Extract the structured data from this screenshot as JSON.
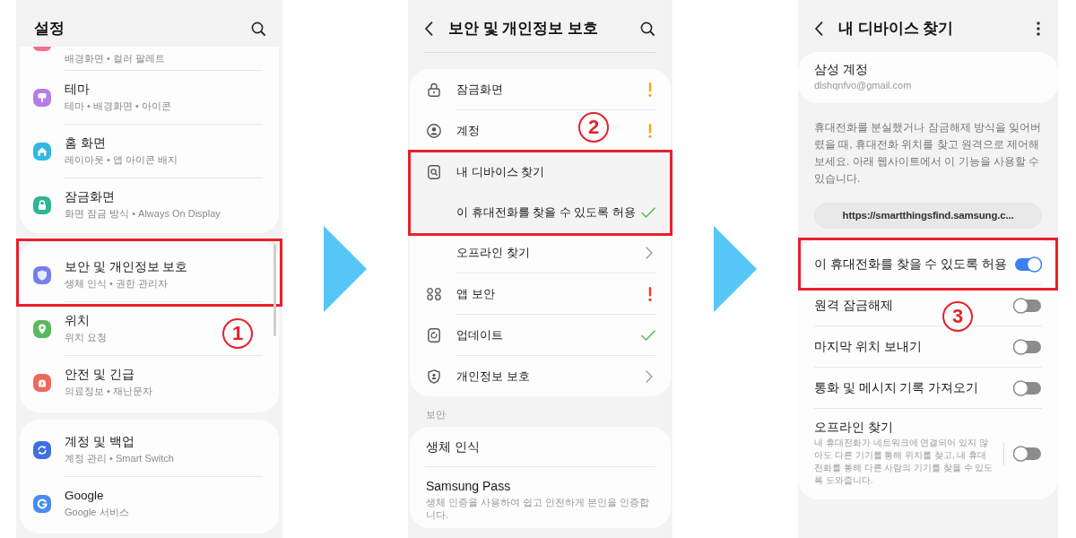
{
  "settings_panel": {
    "title": "설정",
    "groups": [
      {
        "items": [
          {
            "kind": "cut_off",
            "subtitle": "배경화면 • 컬러 팔레트",
            "color": "#f36f8e",
            "highlighted": false
          },
          {
            "kind": "entry",
            "title": "테마",
            "subtitle": "테마 • 배경화면 • 아이콘",
            "color": "#b67ee4",
            "highlighted": false
          },
          {
            "kind": "entry",
            "title": "홈 화면",
            "subtitle": "레이아웃 • 앱 아이콘 배지",
            "color": "#2fb8e3",
            "highlighted": false
          },
          {
            "kind": "entry",
            "title": "잠금화면",
            "subtitle": "화면 잠금 방식 • Always On Display",
            "color": "#2db596",
            "highlighted": false
          }
        ]
      },
      {
        "items": [
          {
            "kind": "entry",
            "title": "보안 및 개인정보 보호",
            "subtitle": "생체 인식 • 권한 관리자",
            "color": "#7480ef",
            "highlighted": true
          },
          {
            "kind": "entry",
            "title": "위치",
            "subtitle": "위치 요청",
            "color": "#5bb85f",
            "highlighted": false
          },
          {
            "kind": "entry",
            "title": "안전 및 긴급",
            "subtitle": "의료정보 • 재난문자",
            "color": "#ec6a5c",
            "highlighted": false
          }
        ]
      },
      {
        "items": [
          {
            "kind": "entry",
            "title": "계정 및 백업",
            "subtitle": "계정 관리 • Smart Switch",
            "color": "#3f6fe0",
            "highlighted": false
          },
          {
            "kind": "entry",
            "title": "Google",
            "subtitle": "Google 서비스",
            "color": "#4a8bf2",
            "highlighted": false
          }
        ]
      }
    ],
    "step_badge": "1"
  },
  "security_panel": {
    "title": "보안 및 개인정보 보호",
    "items": [
      {
        "label": "잠금화면",
        "kind": "warning",
        "highlighted": false
      },
      {
        "label": "계정",
        "kind": "warning",
        "highlighted": false
      },
      {
        "label": "내 디바이스 찾기",
        "kind": "group",
        "highlighted": true,
        "children": [
          {
            "label": "이 휴대전화를 찾을 수 있도록 허용",
            "kind": "done",
            "highlighted": true
          },
          {
            "label": "오프라인 찾기",
            "kind": "link",
            "highlighted": false
          }
        ]
      },
      {
        "label": "앱 보안",
        "kind": "alert",
        "highlighted": false
      },
      {
        "label": "업데이트",
        "kind": "done",
        "highlighted": false
      },
      {
        "label": "개인정보 보호",
        "kind": "link",
        "highlighted": false
      }
    ],
    "step_badge": "2",
    "section": {
      "label": "보안",
      "items": [
        {
          "title": "생체 인식"
        },
        {
          "title": "Samsung Pass",
          "subtitle": "생체 인증을 사용하여 쉽고 안전하게 본인을 인증합니다."
        }
      ]
    }
  },
  "find_device_panel": {
    "title": "내 디바이스 찾기",
    "account": {
      "title": "삼성 계정",
      "email": "dlshqnfvo@gmail.com"
    },
    "description": "휴대전화를 분실했거나 잠금해제 방식을 잊어버렸을 때, 휴대전화 위치를 찾고 원격으로 제어해 보세요. 아래 웹사이트에서 이 기능을 사용할 수 있습니다.",
    "link": "https://smartthingsfind.samsung.c...",
    "toggles": [
      {
        "label": "이 휴대전화를 찾을 수 있도록 허용",
        "on": true,
        "highlighted": true
      },
      {
        "label": "원격 잠금해제",
        "on": false,
        "highlighted": false
      },
      {
        "label": "마지막 위치 보내기",
        "on": false,
        "highlighted": false
      },
      {
        "label": "통화 및 메시지 기록 가져오기",
        "on": false,
        "highlighted": false
      },
      {
        "label": "오프라인 찾기",
        "description": "내 휴대전화가 네트워크에 연결되어 있지 않아도 다른 기기를 통해 위치를 찾고, 내 휴대전화를 통해 다른 사람의 기기를 찾을 수 있도록 도와줍니다.",
        "on": false,
        "highlighted": false
      }
    ],
    "step_badge": "3"
  }
}
